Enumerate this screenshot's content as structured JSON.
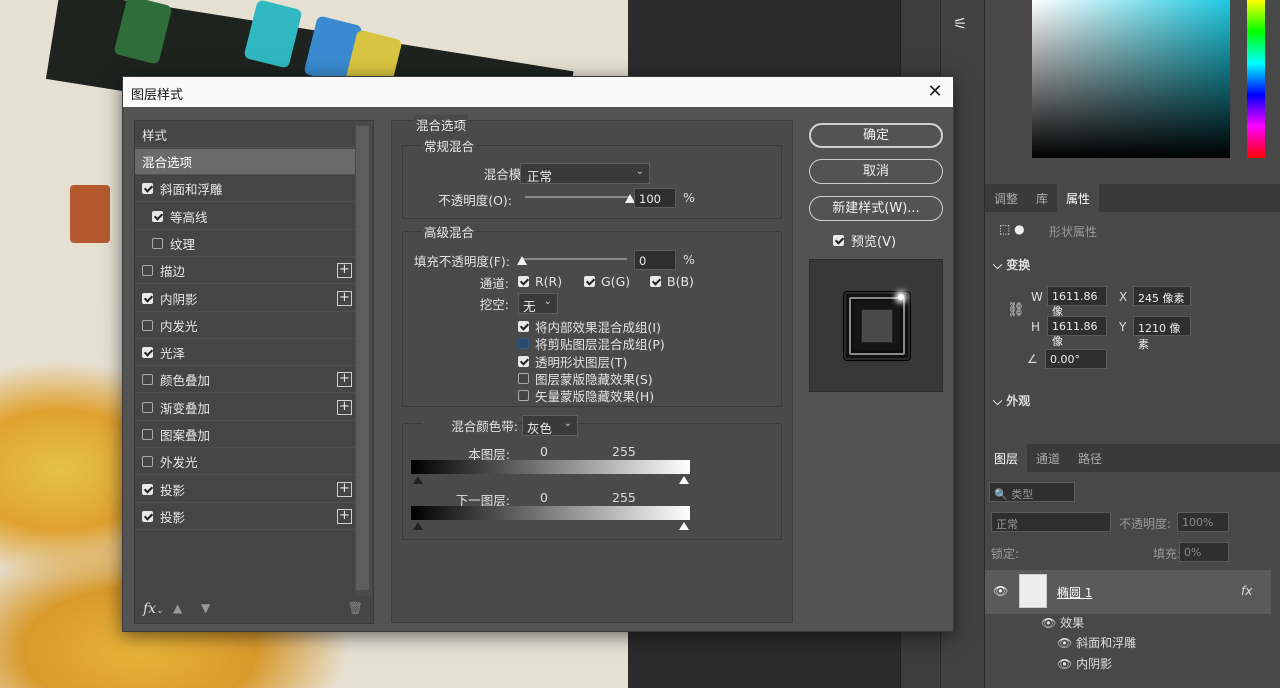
{
  "dialog": {
    "title": "图层样式",
    "close_icon": "close-icon"
  },
  "styles": {
    "header": "样式",
    "items": [
      {
        "label": "混合选项",
        "checkbox": false,
        "checked": false,
        "selected": true,
        "sub": false,
        "plus": false
      },
      {
        "label": "斜面和浮雕",
        "checkbox": true,
        "checked": true,
        "selected": false,
        "sub": false,
        "plus": false
      },
      {
        "label": "等高线",
        "checkbox": true,
        "checked": true,
        "selected": false,
        "sub": true,
        "plus": false
      },
      {
        "label": "纹理",
        "checkbox": true,
        "checked": false,
        "selected": false,
        "sub": true,
        "plus": false
      },
      {
        "label": "描边",
        "checkbox": true,
        "checked": false,
        "selected": false,
        "sub": false,
        "plus": true
      },
      {
        "label": "内阴影",
        "checkbox": true,
        "checked": true,
        "selected": false,
        "sub": false,
        "plus": true
      },
      {
        "label": "内发光",
        "checkbox": true,
        "checked": false,
        "selected": false,
        "sub": false,
        "plus": false
      },
      {
        "label": "光泽",
        "checkbox": true,
        "checked": true,
        "selected": false,
        "sub": false,
        "plus": false
      },
      {
        "label": "颜色叠加",
        "checkbox": true,
        "checked": false,
        "selected": false,
        "sub": false,
        "plus": true
      },
      {
        "label": "渐变叠加",
        "checkbox": true,
        "checked": false,
        "selected": false,
        "sub": false,
        "plus": true
      },
      {
        "label": "图案叠加",
        "checkbox": true,
        "checked": false,
        "selected": false,
        "sub": false,
        "plus": false
      },
      {
        "label": "外发光",
        "checkbox": true,
        "checked": false,
        "selected": false,
        "sub": false,
        "plus": false
      },
      {
        "label": "投影",
        "checkbox": true,
        "checked": true,
        "selected": false,
        "sub": false,
        "plus": true
      },
      {
        "label": "投影",
        "checkbox": true,
        "checked": true,
        "selected": false,
        "sub": false,
        "plus": true
      }
    ],
    "footer": {
      "fx": "fx",
      "up_icon": "arrow-up-icon",
      "down_icon": "arrow-down-icon",
      "trash_icon": "trash-icon"
    }
  },
  "blend": {
    "section_title": "混合选项",
    "general": {
      "title": "常规混合",
      "mode_label": "混合模式:",
      "mode_value": "正常",
      "opacity_label": "不透明度(O):",
      "opacity_value": "100",
      "opacity_unit": "%",
      "opacity_level": 100
    },
    "advanced": {
      "title": "高级混合",
      "fill_label": "填充不透明度(F):",
      "fill_value": "0",
      "fill_unit": "%",
      "fill_level": 0,
      "channels_label": "通道:",
      "channels": [
        {
          "label": "R(R)",
          "checked": true
        },
        {
          "label": "G(G)",
          "checked": true
        },
        {
          "label": "B(B)",
          "checked": true
        }
      ],
      "knockout_label": "挖空:",
      "knockout_value": "无",
      "options": [
        {
          "label": "将内部效果混合成组(I)",
          "checked": true,
          "dim": false
        },
        {
          "label": "将剪贴图层混合成组(P)",
          "checked": false,
          "dim": true
        },
        {
          "label": "透明形状图层(T)",
          "checked": true,
          "dim": false
        },
        {
          "label": "图层蒙版隐藏效果(S)",
          "checked": false,
          "dim": false
        },
        {
          "label": "矢量蒙版隐藏效果(H)",
          "checked": false,
          "dim": false
        }
      ]
    },
    "blend_if": {
      "label": "混合颜色带:",
      "value": "灰色",
      "this_layer_label": "本图层:",
      "this_layer_min": "0",
      "this_layer_max": "255",
      "underlying_label": "下一图层:",
      "underlying_min": "0",
      "underlying_max": "255"
    }
  },
  "buttons": {
    "ok": "确定",
    "cancel": "取消",
    "new_style": "新建样式(W)...",
    "preview_label": "预览(V)",
    "preview_checked": true
  },
  "ps": {
    "tabs": [
      "调整",
      "库",
      "属性"
    ],
    "shape_props": "形状属性",
    "transform_title": "变换",
    "w_label": "W",
    "w_value": "1611.86 像",
    "x_label": "X",
    "x_value": "245 像素",
    "h_label": "H",
    "h_value": "1611.86 像",
    "y_label": "Y",
    "y_value": "1210 像素",
    "angle_value": "0.00°",
    "appearance_title": "外观",
    "layer_tabs": [
      "图层",
      "通道",
      "路径"
    ],
    "kind_label": "类型",
    "blend_mode": "正常",
    "opacity_label": "不透明度:",
    "opacity_value": "100%",
    "lock_label": "锁定:",
    "fill_label": "填充:",
    "fill_value": "0%",
    "layer_name": "椭圆 1",
    "effects_label": "效果",
    "effect_items": [
      "斜面和浮雕",
      "内阴影"
    ]
  }
}
